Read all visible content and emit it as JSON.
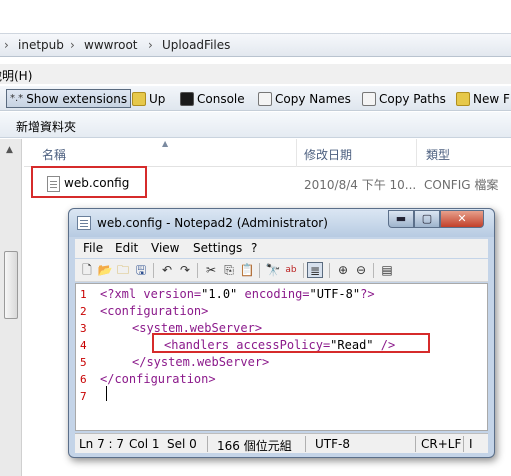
{
  "explorer": {
    "breadcrumb": [
      "inetpub",
      "wwwroot",
      "UploadFiles"
    ],
    "menu_partial": "說明(H)",
    "toolbar": {
      "show_extensions": "Show extensions",
      "up": "Up",
      "console": "Console",
      "copy_names": "Copy Names",
      "copy_paths": "Copy Paths",
      "new": "New F"
    },
    "command": "新增資料夾",
    "columns": {
      "name": "名稱",
      "modified": "修改日期",
      "type": "類型"
    },
    "file": {
      "name": "web.config",
      "modified": "2010/8/4 下午 10...",
      "type": "CONFIG 檔案"
    }
  },
  "notepad": {
    "title": "web.config - Notepad2 (Administrator)",
    "window_buttons": {
      "minimize": "▬",
      "maximize": "▢",
      "close": "✕"
    },
    "menu": [
      "File",
      "Edit",
      "View",
      "Settings",
      "?"
    ],
    "toolbar_icons": [
      "new-icon",
      "open-icon",
      "browse-icon",
      "save-icon",
      "undo-icon",
      "redo-icon",
      "cut-icon",
      "copy-icon",
      "paste-icon",
      "find-icon",
      "replace-icon",
      "word-wrap-icon",
      "zoom-in-icon",
      "zoom-out-icon",
      "scheme-icon"
    ],
    "line_numbers": [
      "1",
      "2",
      "3",
      "4",
      "5",
      "6",
      "7"
    ],
    "code": {
      "l1": {
        "open": "<?xml ",
        "a1": "version=",
        "v1": "\"1.0\"",
        "a2": " encoding=",
        "v2": "\"UTF-8\"",
        "close": "?>"
      },
      "l2": "<configuration>",
      "l3": "<system.webServer>",
      "l4": {
        "open": "<handlers ",
        "attr": "accessPolicy=",
        "val": "\"Read\"",
        "close": " />"
      },
      "l5": "</system.webServer>",
      "l6": "</configuration>"
    },
    "status": {
      "position": "Ln 7 : 7",
      "col": "Col 1",
      "sel": "Sel 0",
      "size": "166 個位元組",
      "encoding": "UTF-8",
      "eol": "CR+LF",
      "ins": "I"
    }
  }
}
